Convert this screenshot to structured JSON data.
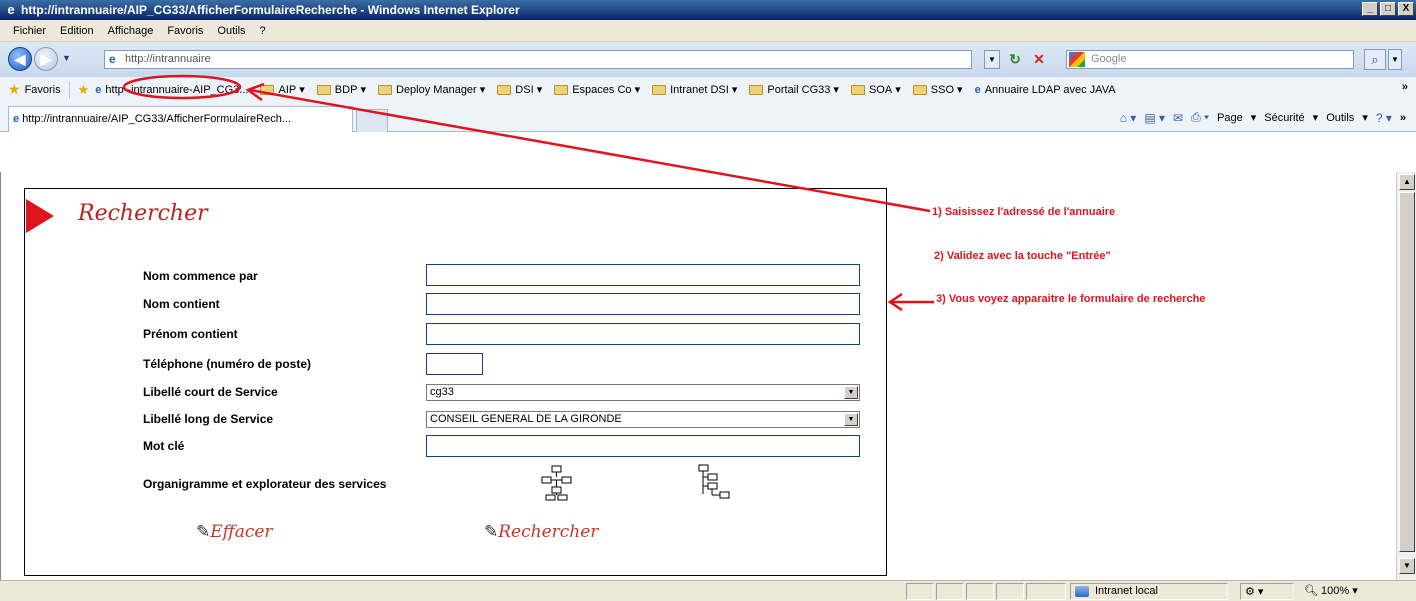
{
  "window": {
    "title": "http://intrannuaire/AIP_CG33/AfficherFormulaireRecherche - Windows Internet Explorer",
    "buttons": [
      "_",
      "□",
      "X"
    ]
  },
  "menu": [
    "Fichier",
    "Edition",
    "Affichage",
    "Favoris",
    "Outils",
    "?"
  ],
  "address": {
    "url": "http://intrannuaire",
    "search_placeholder": "Google"
  },
  "favorites": {
    "label": "Favoris",
    "items": [
      {
        "label": "http--intrannuaire-AIP_CG3...",
        "kind": "page"
      },
      {
        "label": "AIP",
        "kind": "folder"
      },
      {
        "label": "BDP",
        "kind": "folder"
      },
      {
        "label": "Deploy Manager",
        "kind": "folder"
      },
      {
        "label": "DSI",
        "kind": "folder"
      },
      {
        "label": "Espaces Co",
        "kind": "folder"
      },
      {
        "label": "Intranet DSI",
        "kind": "folder"
      },
      {
        "label": "Portail CG33",
        "kind": "folder"
      },
      {
        "label": "SOA",
        "kind": "folder"
      },
      {
        "label": "SSO",
        "kind": "folder"
      },
      {
        "label": "Annuaire LDAP avec JAVA",
        "kind": "page"
      }
    ],
    "more": "»"
  },
  "tab": {
    "label": "http://intrannuaire/AIP_CG33/AfficherFormulaireRech...",
    "commands": [
      "Page",
      "Sécurité",
      "Outils"
    ]
  },
  "form": {
    "title": "Rechercher",
    "fields": [
      {
        "label": "Nom commence par",
        "type": "text",
        "value": ""
      },
      {
        "label": "Nom contient",
        "type": "text",
        "value": ""
      },
      {
        "label": "Prénom contient",
        "type": "text",
        "value": ""
      },
      {
        "label": "Téléphone (numéro de poste)",
        "type": "text-short",
        "value": ""
      },
      {
        "label": "Libellé court de Service",
        "type": "select",
        "value": "cg33"
      },
      {
        "label": "Libellé long de Service",
        "type": "select",
        "value": "CONSEIL GENERAL DE LA GIRONDE"
      },
      {
        "label": "Mot clé",
        "type": "text",
        "value": ""
      }
    ],
    "org_label": "Organigramme et explorateur des services",
    "clear_label": "Effacer",
    "search_label": "Rechercher"
  },
  "annotations": [
    "1) Saisissez l'adressé de l'annuaire",
    "2) Validez avec la touche \"Entrée\"",
    "3) Vous voyez apparaitre le formulaire de recherche"
  ],
  "status": {
    "zone": "Intranet local",
    "zoom": "100%"
  },
  "colors": {
    "annotation": "#e0141e",
    "brand_red": "#b8241c",
    "title_bar": "#0a246a"
  }
}
